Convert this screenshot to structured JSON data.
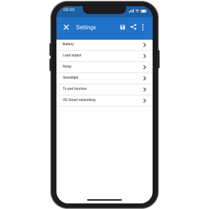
{
  "status_bar": {
    "time": "09:00",
    "background": "#1d5fa3"
  },
  "app_bar": {
    "title": "Settings",
    "background": "#1f73c9",
    "icons": [
      "close-icon",
      "save-icon",
      "share-icon",
      "more-vertical-icon"
    ]
  },
  "settings": {
    "items": [
      {
        "label": "Battery"
      },
      {
        "label": "Load output"
      },
      {
        "label": "Relay"
      },
      {
        "label": "Streetlight"
      },
      {
        "label": "Tx port function"
      },
      {
        "label": "VE.Smart networking"
      }
    ]
  }
}
